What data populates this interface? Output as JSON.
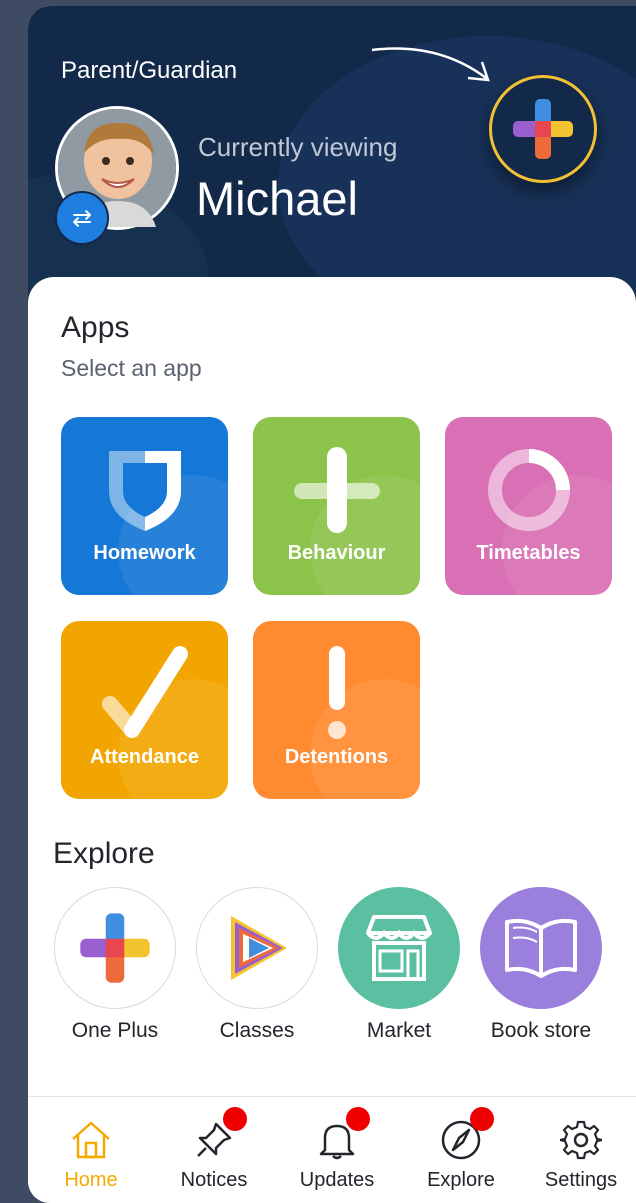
{
  "header": {
    "role": "Parent/Guardian",
    "viewing_label": "Currently viewing",
    "child_name": "Michael"
  },
  "apps": {
    "title": "Apps",
    "subtitle": "Select an app",
    "items": [
      {
        "label": "Homework",
        "color": "#1577d6",
        "icon": "shield-icon"
      },
      {
        "label": "Behaviour",
        "color": "#8cc34a",
        "icon": "plus-icon"
      },
      {
        "label": "Timetables",
        "color": "#d96fb4",
        "icon": "ring-icon"
      },
      {
        "label": "Attendance",
        "color": "#f2a500",
        "icon": "check-icon"
      },
      {
        "label": "Detentions",
        "color": "#ff8a30",
        "icon": "exclamation-icon"
      }
    ]
  },
  "explore": {
    "title": "Explore",
    "items": [
      {
        "label": "One Plus",
        "icon": "colorful-plus-icon"
      },
      {
        "label": "Classes",
        "icon": "play-icon"
      },
      {
        "label": "Market",
        "icon": "storefront-icon",
        "color": "#5bc0a2"
      },
      {
        "label": "Book store",
        "icon": "open-book-icon",
        "color": "#9a7fdc"
      }
    ]
  },
  "nav": {
    "items": [
      {
        "label": "Home",
        "icon": "home-icon",
        "active": true,
        "notification": false
      },
      {
        "label": "Notices",
        "icon": "pin-icon",
        "active": false,
        "notification": true
      },
      {
        "label": "Updates",
        "icon": "bell-icon",
        "active": false,
        "notification": true
      },
      {
        "label": "Explore",
        "icon": "compass-icon",
        "active": false,
        "notification": true
      },
      {
        "label": "Settings",
        "icon": "gear-icon",
        "active": false,
        "notification": false
      }
    ]
  },
  "colors": {
    "header_bg": "#13294a",
    "accent": "#f2a900",
    "plus_ring": "#f2c133",
    "notification": "#ee0000"
  }
}
